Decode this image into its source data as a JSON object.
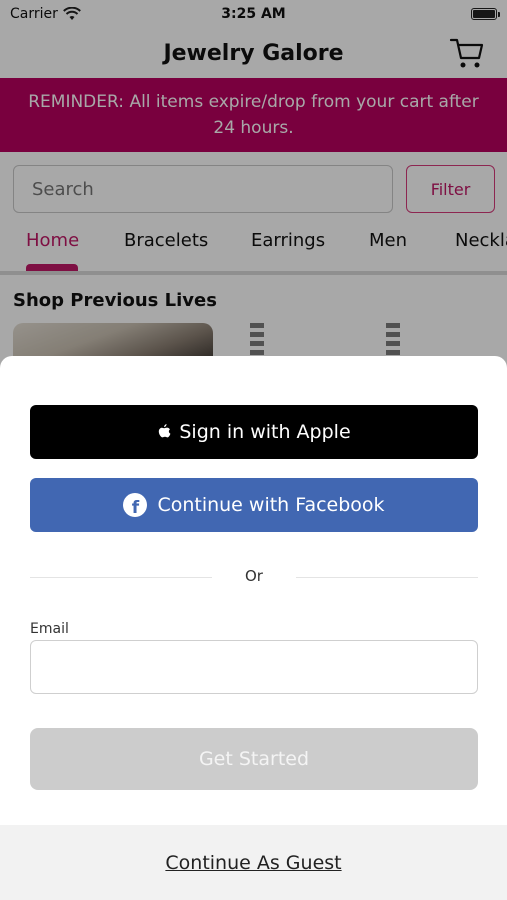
{
  "status_bar": {
    "carrier": "Carrier",
    "time": "3:25 AM"
  },
  "nav": {
    "title": "Jewelry Galore"
  },
  "reminder": {
    "text": "REMINDER: All items expire/drop from your cart after 24 hours."
  },
  "search": {
    "placeholder": "Search",
    "filter_label": "Filter"
  },
  "tabs": [
    "Home",
    "Bracelets",
    "Earrings",
    "Men",
    "Neckla"
  ],
  "section": {
    "title": "Shop Previous Lives"
  },
  "sheet": {
    "apple_label": "Sign in with Apple",
    "facebook_label": "Continue with Facebook",
    "or_label": "Or",
    "email_label": "Email",
    "email_value": "",
    "get_started_label": "Get Started",
    "guest_label": "Continue As Guest"
  },
  "colors": {
    "brand": "#b8005e",
    "accent": "#c01866",
    "facebook": "#4167b2"
  },
  "icons": [
    "wifi-icon",
    "battery-icon",
    "cart-icon",
    "apple-icon",
    "facebook-icon"
  ]
}
